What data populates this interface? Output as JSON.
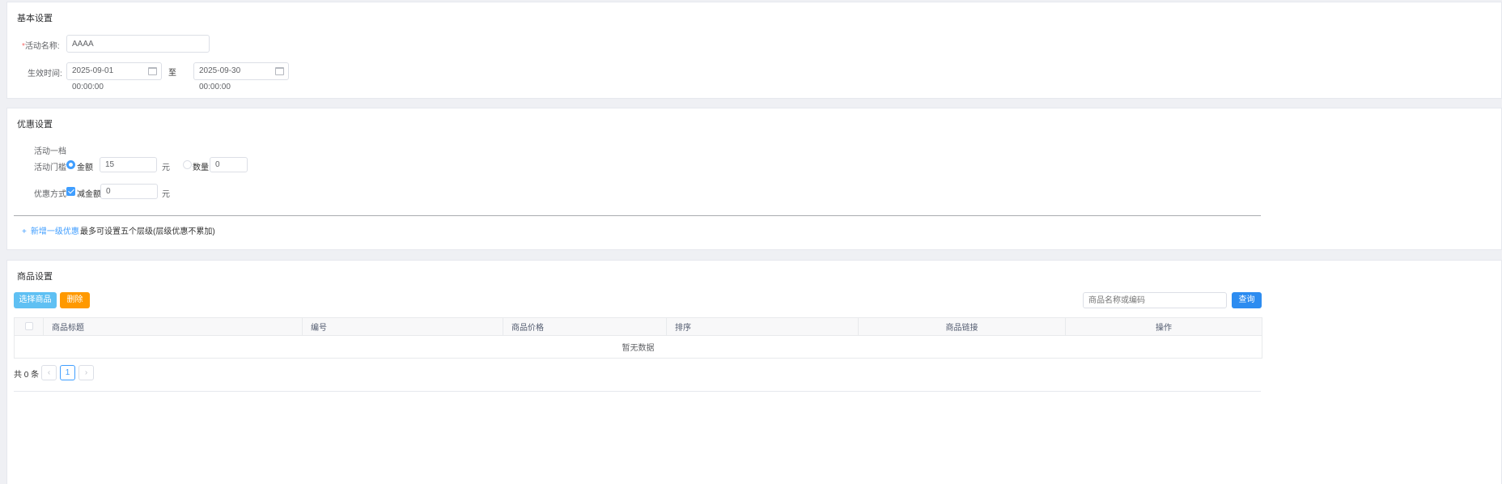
{
  "basic": {
    "title": "基本设置",
    "required_mark": "*",
    "name_label": "活动名称:",
    "name_value": "AAAA",
    "time_label": "生效时间:",
    "start_time": "2025-09-01 00:00:00",
    "to_label": "至",
    "end_time": "2025-09-30 00:00:00"
  },
  "discount": {
    "title": "优惠设置",
    "tier_label": "活动一档",
    "threshold_label": "活动门槛",
    "amount_option": "金额",
    "amount_value": "15",
    "unit": "元",
    "quantity_option": "数量",
    "quantity_value": "0",
    "method_label": "优惠方式",
    "reduce_option": "减金额",
    "reduce_value": "0",
    "reduce_unit": "元",
    "add_tier_icon": "plus-icon",
    "add_tier_label": "新增一级优惠",
    "add_tier_hint": "最多可设置五个层级(层级优惠不累加)"
  },
  "goods": {
    "title": "商品设置",
    "select_button": "选择商品",
    "delete_button": "删除",
    "search_placeholder": "商品名称或编码",
    "query_button": "查询",
    "columns": [
      "商品标题",
      "编号",
      "商品价格",
      "排序",
      "商品链接",
      "操作"
    ],
    "empty_text": "暂无数据",
    "total_text": "共 0 条",
    "prev_icon": "chevron-left-icon",
    "next_icon": "chevron-right-icon",
    "current_page": "1"
  },
  "colors": {
    "primary": "#409eff",
    "select_btn": "#5fc0f3",
    "delete_btn": "#ff9900",
    "query_btn": "#2d8cf0",
    "required": "#f56c6c"
  }
}
